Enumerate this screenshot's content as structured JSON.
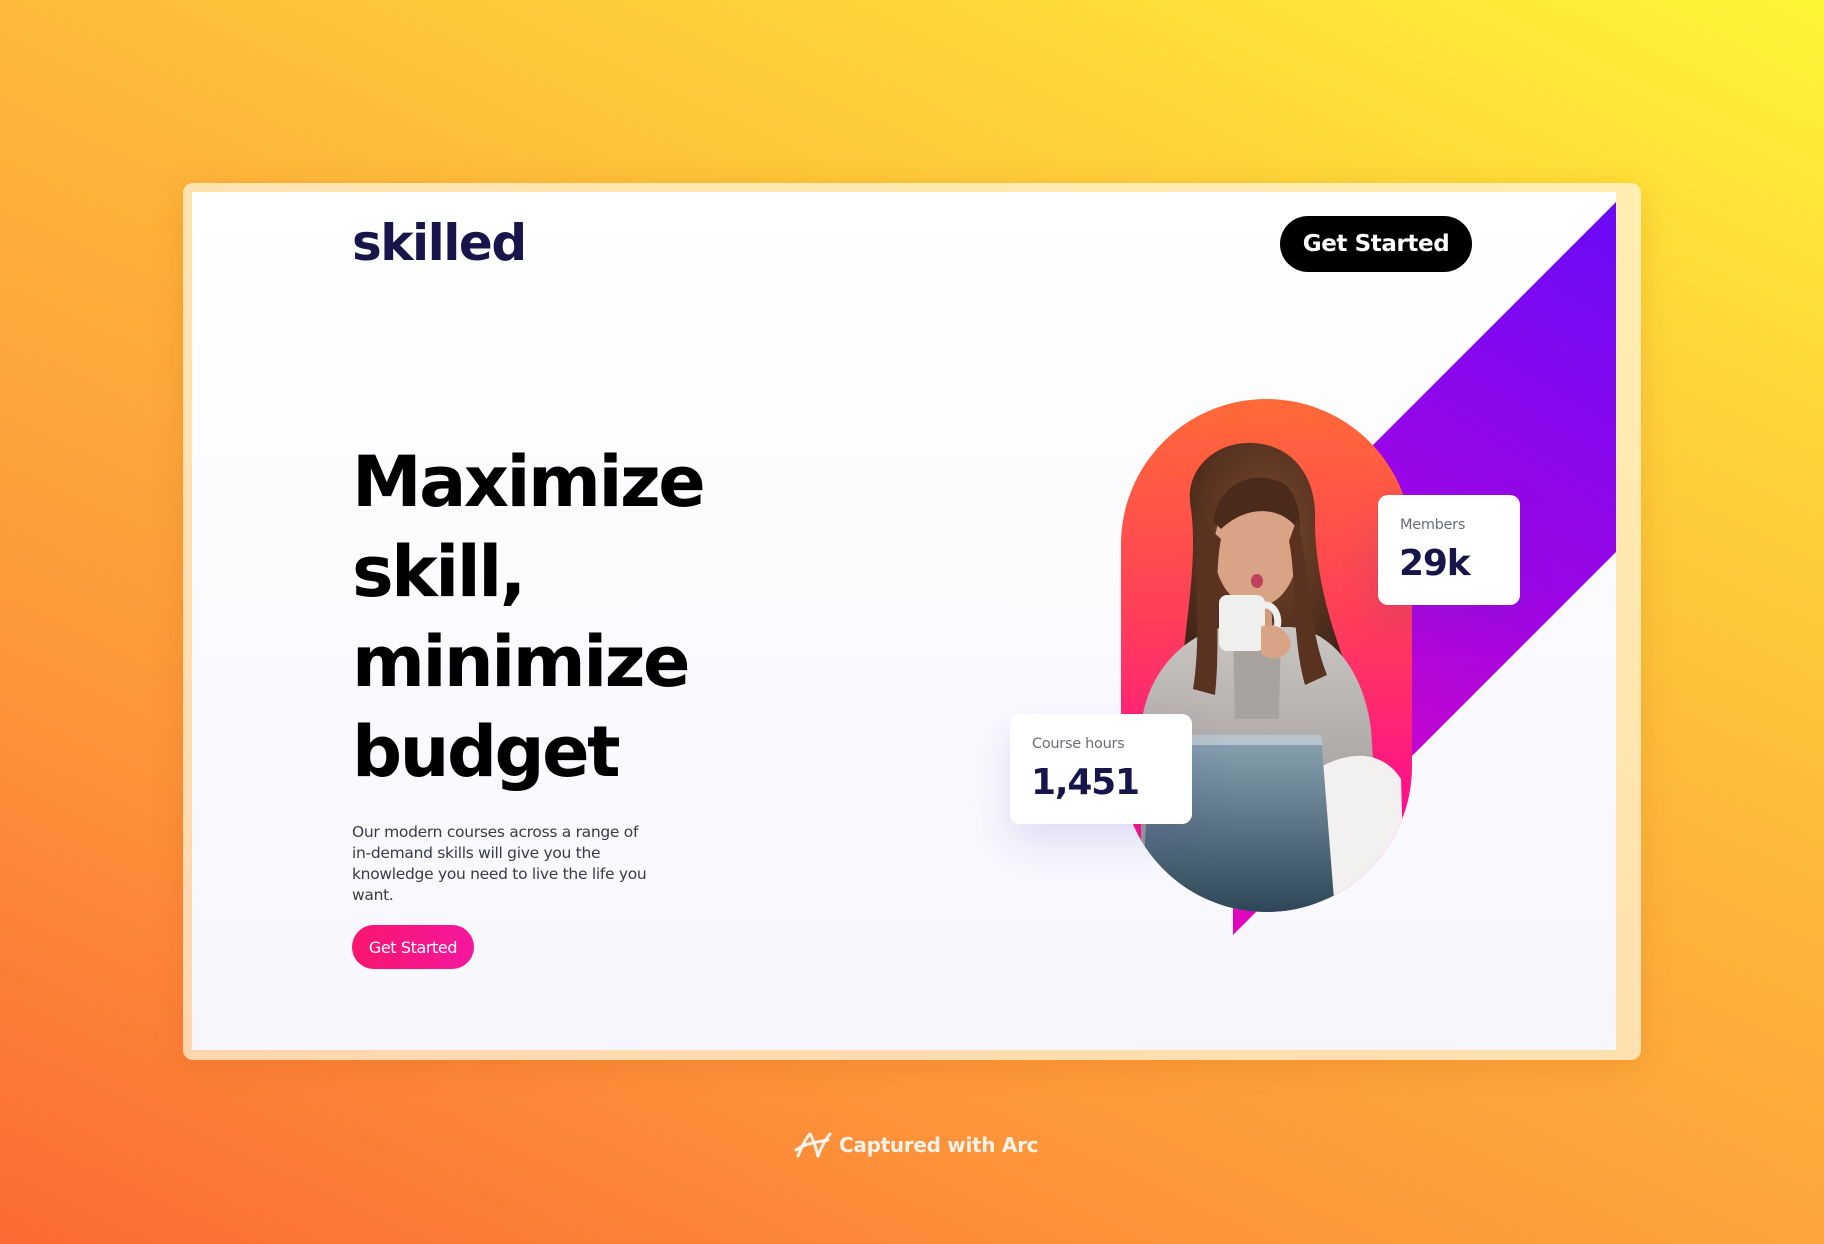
{
  "site": {
    "logo": "skilled",
    "nav_cta": "Get Started"
  },
  "hero": {
    "headline_lines": [
      "Maximize",
      "skill,",
      "minimize",
      "budget"
    ],
    "subtext": "Our modern courses across a range of in-demand skills will give you the knowledge you need to live the life you want.",
    "cta": "Get Started"
  },
  "stats": {
    "members": {
      "label": "Members",
      "value": "29k"
    },
    "course_hours": {
      "label": "Course hours",
      "value": "1,451"
    }
  },
  "footer": {
    "caption": "Captured with Arc",
    "icon": "arc-logo-icon"
  },
  "colors": {
    "brand_navy": "#17154a",
    "cta_pink": "#f8166d",
    "diagonal_start": "#6a0bf7",
    "diagonal_end": "#de07c4",
    "pill_top": "#ff6a37",
    "pill_bottom": "#ff0b96"
  }
}
